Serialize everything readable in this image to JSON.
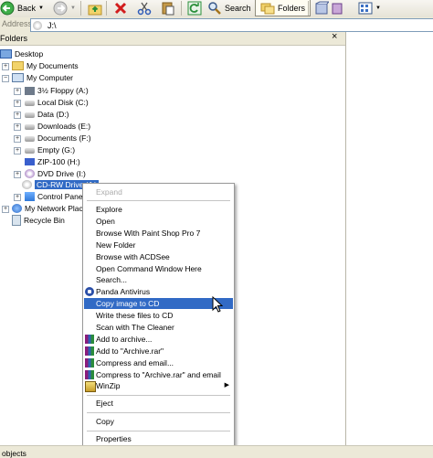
{
  "toolbar": {
    "back_label": "Back",
    "search_label": "Search",
    "folders_label": "Folders"
  },
  "address": {
    "label": "Address",
    "value": "J:\\"
  },
  "pane": {
    "title": "Folders",
    "close_glyph": "×"
  },
  "tree": {
    "desktop": "Desktop",
    "my_documents": "My Documents",
    "my_computer": "My Computer",
    "floppy": "3½ Floppy (A:)",
    "local_disk": "Local Disk (C:)",
    "data": "Data (D:)",
    "downloads": "Downloads (E:)",
    "documents": "Documents (F:)",
    "empty": "Empty (G:)",
    "zip": "ZIP-100 (H:)",
    "dvd": "DVD Drive (I:)",
    "cdrw": "CD-RW Drive (J:)",
    "control_panel": "Control Panel",
    "network": "My Network Places",
    "recycle": "Recycle Bin"
  },
  "menu": {
    "expand": "Expand",
    "explore": "Explore",
    "open": "Open",
    "paintshop": "Browse With Paint Shop Pro 7",
    "new_folder": "New Folder",
    "acdsee": "Browse with ACDSee",
    "cmd": "Open Command Window Here",
    "search": "Search...",
    "panda": "Panda Antivirus",
    "copy_image": "Copy image to CD",
    "write_files": "Write these files to CD",
    "cleaner": "Scan with The Cleaner",
    "add_archive": "Add to archive...",
    "add_rar": "Add to \"Archive.rar\"",
    "compress_email": "Compress and email...",
    "compress_rar_email": "Compress to \"Archive.rar\" and email",
    "winzip": "WinZip",
    "eject": "Eject",
    "copy": "Copy",
    "properties": "Properties",
    "submenu_arrow": "▶"
  },
  "status": {
    "text": "objects"
  },
  "icons": {
    "back": "back-arrow-icon",
    "forward": "forward-arrow-icon",
    "up": "up-folder-icon",
    "delete": "delete-x-icon",
    "cut": "cut-scissors-icon",
    "paste": "paste-icon",
    "refresh": "refresh-icon",
    "search": "search-magnifier-icon",
    "folders": "folders-icon",
    "views": "views-icon"
  },
  "colors": {
    "selection": "#316ac5",
    "toolbar_bg": "#ece9d8",
    "menu_border": "#999999"
  }
}
